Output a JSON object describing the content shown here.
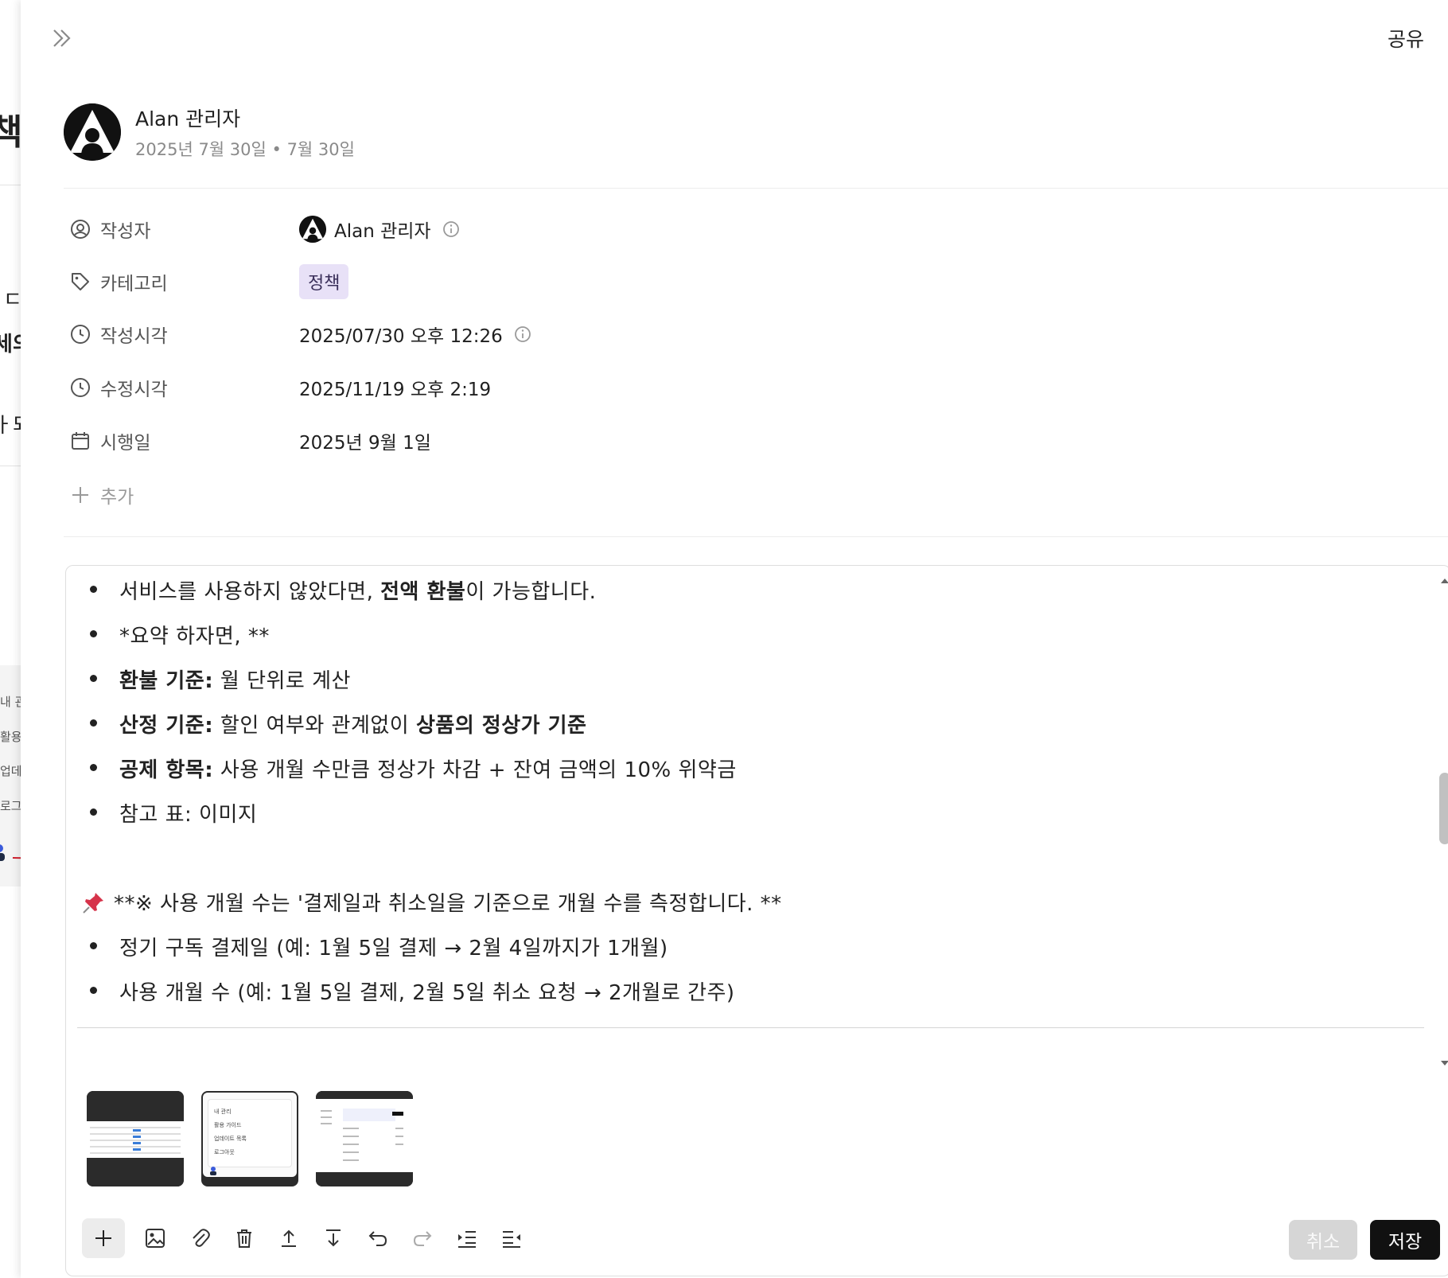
{
  "header": {
    "share_label": "공유"
  },
  "author": {
    "name": "Alan 관리자",
    "date": "2025년 7월 30일 • 7월 30일"
  },
  "properties": {
    "author_label": "작성자",
    "author_value": "Alan 관리자",
    "category_label": "카테고리",
    "category_value": "정책",
    "created_label": "작성시각",
    "created_value": "2025/07/30 오후 12:26",
    "modified_label": "수정시각",
    "modified_value": "2025/11/19 오후 2:19",
    "effective_label": "시행일",
    "effective_value": "2025년 9월 1일",
    "add_label": "추가"
  },
  "editor": {
    "lines": [
      {
        "pre": "서비스를 사용하지 않았다면, ",
        "bold": "전액 환불",
        "post": "이 가능합니다."
      },
      {
        "text": "*요약 하자면, **"
      },
      {
        "bold": "환불 기준:",
        "post": " 월 단위로 계산"
      },
      {
        "bold": "산정 기준:",
        "mid": " 할인 여부와 관계없이 ",
        "bold2": "상품의 정상가 기준"
      },
      {
        "bold": "공제 항목:",
        "post": " 사용 개월 수만큼 정상가 차감 + 잔여 금액의 10% 위약금"
      },
      {
        "text": "참고 표: 이미지"
      }
    ],
    "pin_note": "**※ 사용 개월 수는 '결제일과 취소일을 기준으로 개월 수를 측정합니다. **",
    "lines2": [
      "정기 구독 결제일 (예: 1월 5일 결제 → 2월 4일까지가 1개월)",
      "사용 개월 수 (예: 1월 5일 결제, 2월 5일 취소 요청 → 2개월로 간주)"
    ],
    "attachments": [
      {
        "name": "attachment-1",
        "menu_items": []
      },
      {
        "name": "attachment-2",
        "menu_items": [
          "내 관리",
          "활용 가이드",
          "업데이트 목록",
          "로그아웃"
        ]
      },
      {
        "name": "attachment-3",
        "menu_items": []
      }
    ],
    "toolbar": {
      "icons": [
        "plus-icon",
        "image-icon",
        "attach-icon",
        "trash-icon",
        "upload-icon",
        "download-icon",
        "undo-icon",
        "redo-icon",
        "indent-icon",
        "outdent-icon"
      ]
    },
    "cancel_label": "취소",
    "save_label": "저장"
  },
  "background_page": {
    "fragments": [
      "책",
      "ㄷ",
      "세의",
      "ㅏ되"
    ],
    "menu_items": [
      "내 관",
      "활용",
      "업데",
      "로그"
    ]
  },
  "colors": {
    "chip_bg": "#e8e1f7",
    "save_bg": "#111111",
    "cancel_bg": "#d6d6d6",
    "annotation": "#d0202e"
  }
}
